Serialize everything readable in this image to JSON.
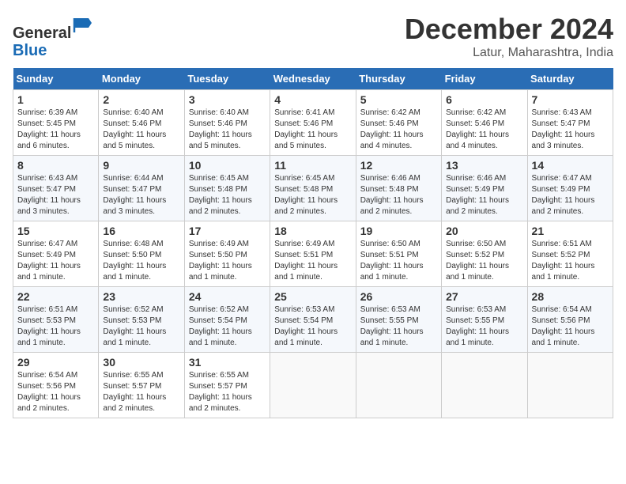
{
  "header": {
    "logo_line1": "General",
    "logo_line2": "Blue",
    "month": "December 2024",
    "location": "Latur, Maharashtra, India"
  },
  "weekdays": [
    "Sunday",
    "Monday",
    "Tuesday",
    "Wednesday",
    "Thursday",
    "Friday",
    "Saturday"
  ],
  "weeks": [
    [
      {
        "day": "1",
        "sunrise": "Sunrise: 6:39 AM",
        "sunset": "Sunset: 5:45 PM",
        "daylight": "Daylight: 11 hours and 6 minutes."
      },
      {
        "day": "2",
        "sunrise": "Sunrise: 6:40 AM",
        "sunset": "Sunset: 5:46 PM",
        "daylight": "Daylight: 11 hours and 5 minutes."
      },
      {
        "day": "3",
        "sunrise": "Sunrise: 6:40 AM",
        "sunset": "Sunset: 5:46 PM",
        "daylight": "Daylight: 11 hours and 5 minutes."
      },
      {
        "day": "4",
        "sunrise": "Sunrise: 6:41 AM",
        "sunset": "Sunset: 5:46 PM",
        "daylight": "Daylight: 11 hours and 5 minutes."
      },
      {
        "day": "5",
        "sunrise": "Sunrise: 6:42 AM",
        "sunset": "Sunset: 5:46 PM",
        "daylight": "Daylight: 11 hours and 4 minutes."
      },
      {
        "day": "6",
        "sunrise": "Sunrise: 6:42 AM",
        "sunset": "Sunset: 5:46 PM",
        "daylight": "Daylight: 11 hours and 4 minutes."
      },
      {
        "day": "7",
        "sunrise": "Sunrise: 6:43 AM",
        "sunset": "Sunset: 5:47 PM",
        "daylight": "Daylight: 11 hours and 3 minutes."
      }
    ],
    [
      {
        "day": "8",
        "sunrise": "Sunrise: 6:43 AM",
        "sunset": "Sunset: 5:47 PM",
        "daylight": "Daylight: 11 hours and 3 minutes."
      },
      {
        "day": "9",
        "sunrise": "Sunrise: 6:44 AM",
        "sunset": "Sunset: 5:47 PM",
        "daylight": "Daylight: 11 hours and 3 minutes."
      },
      {
        "day": "10",
        "sunrise": "Sunrise: 6:45 AM",
        "sunset": "Sunset: 5:48 PM",
        "daylight": "Daylight: 11 hours and 2 minutes."
      },
      {
        "day": "11",
        "sunrise": "Sunrise: 6:45 AM",
        "sunset": "Sunset: 5:48 PM",
        "daylight": "Daylight: 11 hours and 2 minutes."
      },
      {
        "day": "12",
        "sunrise": "Sunrise: 6:46 AM",
        "sunset": "Sunset: 5:48 PM",
        "daylight": "Daylight: 11 hours and 2 minutes."
      },
      {
        "day": "13",
        "sunrise": "Sunrise: 6:46 AM",
        "sunset": "Sunset: 5:49 PM",
        "daylight": "Daylight: 11 hours and 2 minutes."
      },
      {
        "day": "14",
        "sunrise": "Sunrise: 6:47 AM",
        "sunset": "Sunset: 5:49 PM",
        "daylight": "Daylight: 11 hours and 2 minutes."
      }
    ],
    [
      {
        "day": "15",
        "sunrise": "Sunrise: 6:47 AM",
        "sunset": "Sunset: 5:49 PM",
        "daylight": "Daylight: 11 hours and 1 minute."
      },
      {
        "day": "16",
        "sunrise": "Sunrise: 6:48 AM",
        "sunset": "Sunset: 5:50 PM",
        "daylight": "Daylight: 11 hours and 1 minute."
      },
      {
        "day": "17",
        "sunrise": "Sunrise: 6:49 AM",
        "sunset": "Sunset: 5:50 PM",
        "daylight": "Daylight: 11 hours and 1 minute."
      },
      {
        "day": "18",
        "sunrise": "Sunrise: 6:49 AM",
        "sunset": "Sunset: 5:51 PM",
        "daylight": "Daylight: 11 hours and 1 minute."
      },
      {
        "day": "19",
        "sunrise": "Sunrise: 6:50 AM",
        "sunset": "Sunset: 5:51 PM",
        "daylight": "Daylight: 11 hours and 1 minute."
      },
      {
        "day": "20",
        "sunrise": "Sunrise: 6:50 AM",
        "sunset": "Sunset: 5:52 PM",
        "daylight": "Daylight: 11 hours and 1 minute."
      },
      {
        "day": "21",
        "sunrise": "Sunrise: 6:51 AM",
        "sunset": "Sunset: 5:52 PM",
        "daylight": "Daylight: 11 hours and 1 minute."
      }
    ],
    [
      {
        "day": "22",
        "sunrise": "Sunrise: 6:51 AM",
        "sunset": "Sunset: 5:53 PM",
        "daylight": "Daylight: 11 hours and 1 minute."
      },
      {
        "day": "23",
        "sunrise": "Sunrise: 6:52 AM",
        "sunset": "Sunset: 5:53 PM",
        "daylight": "Daylight: 11 hours and 1 minute."
      },
      {
        "day": "24",
        "sunrise": "Sunrise: 6:52 AM",
        "sunset": "Sunset: 5:54 PM",
        "daylight": "Daylight: 11 hours and 1 minute."
      },
      {
        "day": "25",
        "sunrise": "Sunrise: 6:53 AM",
        "sunset": "Sunset: 5:54 PM",
        "daylight": "Daylight: 11 hours and 1 minute."
      },
      {
        "day": "26",
        "sunrise": "Sunrise: 6:53 AM",
        "sunset": "Sunset: 5:55 PM",
        "daylight": "Daylight: 11 hours and 1 minute."
      },
      {
        "day": "27",
        "sunrise": "Sunrise: 6:53 AM",
        "sunset": "Sunset: 5:55 PM",
        "daylight": "Daylight: 11 hours and 1 minute."
      },
      {
        "day": "28",
        "sunrise": "Sunrise: 6:54 AM",
        "sunset": "Sunset: 5:56 PM",
        "daylight": "Daylight: 11 hours and 1 minute."
      }
    ],
    [
      {
        "day": "29",
        "sunrise": "Sunrise: 6:54 AM",
        "sunset": "Sunset: 5:56 PM",
        "daylight": "Daylight: 11 hours and 2 minutes."
      },
      {
        "day": "30",
        "sunrise": "Sunrise: 6:55 AM",
        "sunset": "Sunset: 5:57 PM",
        "daylight": "Daylight: 11 hours and 2 minutes."
      },
      {
        "day": "31",
        "sunrise": "Sunrise: 6:55 AM",
        "sunset": "Sunset: 5:57 PM",
        "daylight": "Daylight: 11 hours and 2 minutes."
      },
      null,
      null,
      null,
      null
    ]
  ]
}
